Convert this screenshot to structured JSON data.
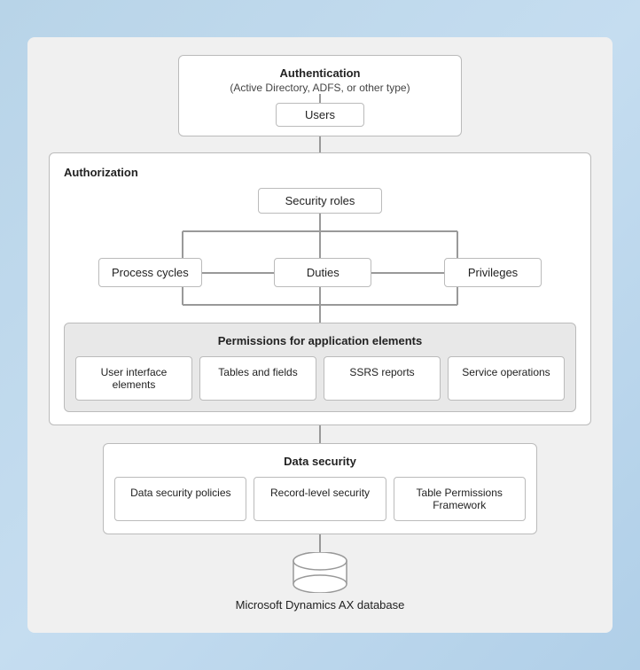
{
  "auth": {
    "title": "Authentication",
    "subtitle": "(Active Directory, ADFS, or other type)",
    "users_label": "Users"
  },
  "authorization": {
    "label": "Authorization",
    "security_roles": "Security roles",
    "process_cycles": "Process cycles",
    "duties": "Duties",
    "privileges": "Privileges"
  },
  "permissions": {
    "label": "Permissions for application elements",
    "items": [
      "User interface elements",
      "Tables and fields",
      "SSRS reports",
      "Service operations"
    ]
  },
  "data_security": {
    "label": "Data security",
    "items": [
      "Data security policies",
      "Record-level security",
      "Table Permissions Framework"
    ]
  },
  "database": {
    "label": "Microsoft Dynamics AX database"
  }
}
